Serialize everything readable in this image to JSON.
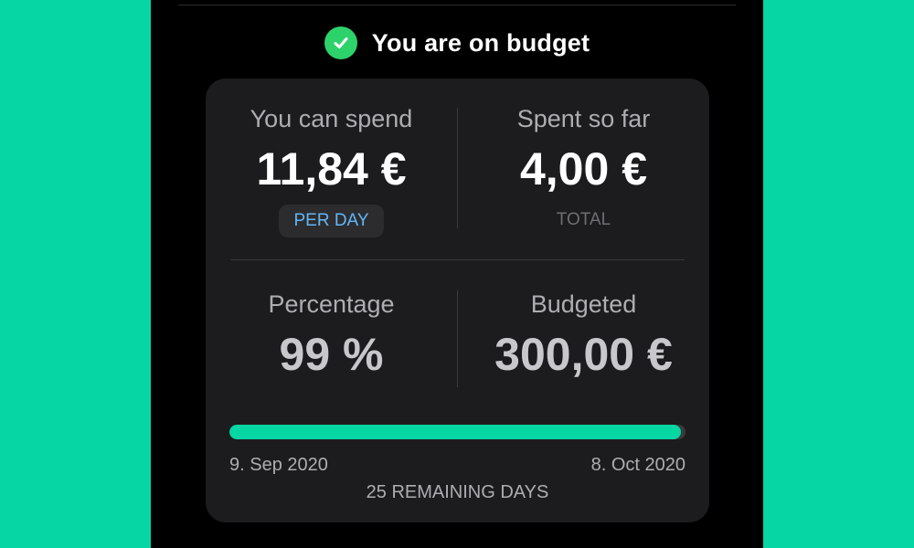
{
  "status": {
    "text": "You are on budget",
    "icon": "checkmark-circle-icon",
    "icon_color": "#2ed26b"
  },
  "summary": {
    "can_spend_label": "You can spend",
    "can_spend_value": "11,84 €",
    "per_day_label": "PER DAY",
    "spent_label": "Spent so far",
    "spent_value": "4,00 €",
    "total_label": "TOTAL",
    "percentage_label": "Percentage",
    "percentage_value": "99 %",
    "budgeted_label": "Budgeted",
    "budgeted_value": "300,00 €"
  },
  "period": {
    "start_date": "9. Sep 2020",
    "end_date": "8. Oct 2020",
    "remaining_text": "25 REMAINING DAYS",
    "progress_fraction": 0.99
  },
  "colors": {
    "accent": "#05d6a3",
    "card_background": "#1c1c1e",
    "badge_text": "#64b5f6"
  }
}
